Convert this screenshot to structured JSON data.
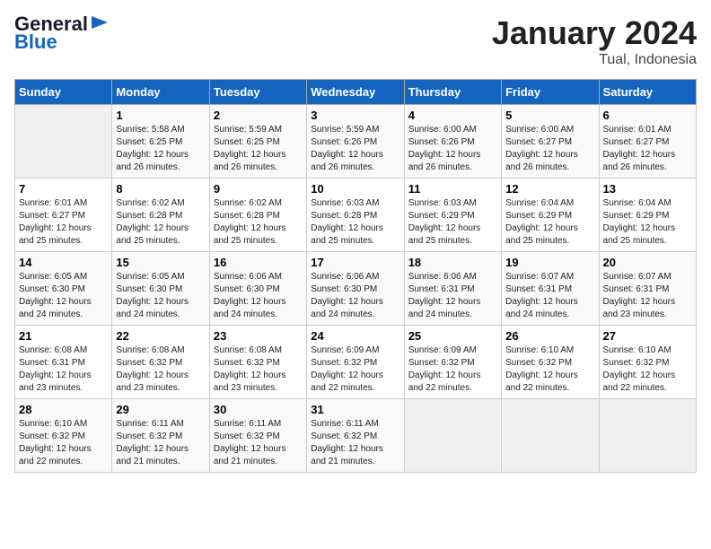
{
  "header": {
    "logo_line1": "General",
    "logo_line2": "Blue",
    "month": "January 2024",
    "location": "Tual, Indonesia"
  },
  "weekdays": [
    "Sunday",
    "Monday",
    "Tuesday",
    "Wednesday",
    "Thursday",
    "Friday",
    "Saturday"
  ],
  "weeks": [
    [
      {
        "day": "",
        "empty": true
      },
      {
        "day": "1",
        "sunrise": "5:58 AM",
        "sunset": "6:25 PM",
        "daylight": "12 hours and 26 minutes."
      },
      {
        "day": "2",
        "sunrise": "5:59 AM",
        "sunset": "6:25 PM",
        "daylight": "12 hours and 26 minutes."
      },
      {
        "day": "3",
        "sunrise": "5:59 AM",
        "sunset": "6:26 PM",
        "daylight": "12 hours and 26 minutes."
      },
      {
        "day": "4",
        "sunrise": "6:00 AM",
        "sunset": "6:26 PM",
        "daylight": "12 hours and 26 minutes."
      },
      {
        "day": "5",
        "sunrise": "6:00 AM",
        "sunset": "6:27 PM",
        "daylight": "12 hours and 26 minutes."
      },
      {
        "day": "6",
        "sunrise": "6:01 AM",
        "sunset": "6:27 PM",
        "daylight": "12 hours and 26 minutes."
      }
    ],
    [
      {
        "day": "7",
        "sunrise": "6:01 AM",
        "sunset": "6:27 PM",
        "daylight": "12 hours and 25 minutes."
      },
      {
        "day": "8",
        "sunrise": "6:02 AM",
        "sunset": "6:28 PM",
        "daylight": "12 hours and 25 minutes."
      },
      {
        "day": "9",
        "sunrise": "6:02 AM",
        "sunset": "6:28 PM",
        "daylight": "12 hours and 25 minutes."
      },
      {
        "day": "10",
        "sunrise": "6:03 AM",
        "sunset": "6:28 PM",
        "daylight": "12 hours and 25 minutes."
      },
      {
        "day": "11",
        "sunrise": "6:03 AM",
        "sunset": "6:29 PM",
        "daylight": "12 hours and 25 minutes."
      },
      {
        "day": "12",
        "sunrise": "6:04 AM",
        "sunset": "6:29 PM",
        "daylight": "12 hours and 25 minutes."
      },
      {
        "day": "13",
        "sunrise": "6:04 AM",
        "sunset": "6:29 PM",
        "daylight": "12 hours and 25 minutes."
      }
    ],
    [
      {
        "day": "14",
        "sunrise": "6:05 AM",
        "sunset": "6:30 PM",
        "daylight": "12 hours and 24 minutes."
      },
      {
        "day": "15",
        "sunrise": "6:05 AM",
        "sunset": "6:30 PM",
        "daylight": "12 hours and 24 minutes."
      },
      {
        "day": "16",
        "sunrise": "6:06 AM",
        "sunset": "6:30 PM",
        "daylight": "12 hours and 24 minutes."
      },
      {
        "day": "17",
        "sunrise": "6:06 AM",
        "sunset": "6:30 PM",
        "daylight": "12 hours and 24 minutes."
      },
      {
        "day": "18",
        "sunrise": "6:06 AM",
        "sunset": "6:31 PM",
        "daylight": "12 hours and 24 minutes."
      },
      {
        "day": "19",
        "sunrise": "6:07 AM",
        "sunset": "6:31 PM",
        "daylight": "12 hours and 24 minutes."
      },
      {
        "day": "20",
        "sunrise": "6:07 AM",
        "sunset": "6:31 PM",
        "daylight": "12 hours and 23 minutes."
      }
    ],
    [
      {
        "day": "21",
        "sunrise": "6:08 AM",
        "sunset": "6:31 PM",
        "daylight": "12 hours and 23 minutes."
      },
      {
        "day": "22",
        "sunrise": "6:08 AM",
        "sunset": "6:32 PM",
        "daylight": "12 hours and 23 minutes."
      },
      {
        "day": "23",
        "sunrise": "6:08 AM",
        "sunset": "6:32 PM",
        "daylight": "12 hours and 23 minutes."
      },
      {
        "day": "24",
        "sunrise": "6:09 AM",
        "sunset": "6:32 PM",
        "daylight": "12 hours and 22 minutes."
      },
      {
        "day": "25",
        "sunrise": "6:09 AM",
        "sunset": "6:32 PM",
        "daylight": "12 hours and 22 minutes."
      },
      {
        "day": "26",
        "sunrise": "6:10 AM",
        "sunset": "6:32 PM",
        "daylight": "12 hours and 22 minutes."
      },
      {
        "day": "27",
        "sunrise": "6:10 AM",
        "sunset": "6:32 PM",
        "daylight": "12 hours and 22 minutes."
      }
    ],
    [
      {
        "day": "28",
        "sunrise": "6:10 AM",
        "sunset": "6:32 PM",
        "daylight": "12 hours and 22 minutes."
      },
      {
        "day": "29",
        "sunrise": "6:11 AM",
        "sunset": "6:32 PM",
        "daylight": "12 hours and 21 minutes."
      },
      {
        "day": "30",
        "sunrise": "6:11 AM",
        "sunset": "6:32 PM",
        "daylight": "12 hours and 21 minutes."
      },
      {
        "day": "31",
        "sunrise": "6:11 AM",
        "sunset": "6:32 PM",
        "daylight": "12 hours and 21 minutes."
      },
      {
        "day": "",
        "empty": true
      },
      {
        "day": "",
        "empty": true
      },
      {
        "day": "",
        "empty": true
      }
    ]
  ]
}
